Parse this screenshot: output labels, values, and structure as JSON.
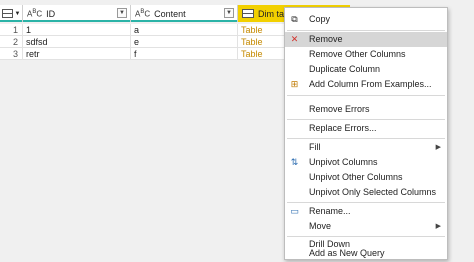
{
  "table": {
    "columns": [
      {
        "type": "ABC",
        "name": "ID"
      },
      {
        "type": "ABC",
        "name": "Content"
      },
      {
        "type": "table",
        "name": "Dim table"
      }
    ],
    "rows": [
      {
        "num": "1",
        "id": "1",
        "content": "a",
        "dim": "Table"
      },
      {
        "num": "2",
        "id": "sdfsd",
        "content": "e",
        "dim": "Table"
      },
      {
        "num": "3",
        "id": "retr",
        "content": "f",
        "dim": "Table"
      }
    ]
  },
  "menu": {
    "copy": "Copy",
    "remove": "Remove",
    "remove_other": "Remove Other Columns",
    "duplicate": "Duplicate Column",
    "add_from_examples": "Add Column From Examples...",
    "remove_errors": "Remove Errors",
    "replace_errors": "Replace Errors...",
    "fill": "Fill",
    "unpivot": "Unpivot Columns",
    "unpivot_other": "Unpivot Other Columns",
    "unpivot_selected": "Unpivot Only Selected Columns",
    "rename": "Rename...",
    "move": "Move",
    "drill_down": "Drill Down",
    "add_new_query": "Add as New Query"
  }
}
